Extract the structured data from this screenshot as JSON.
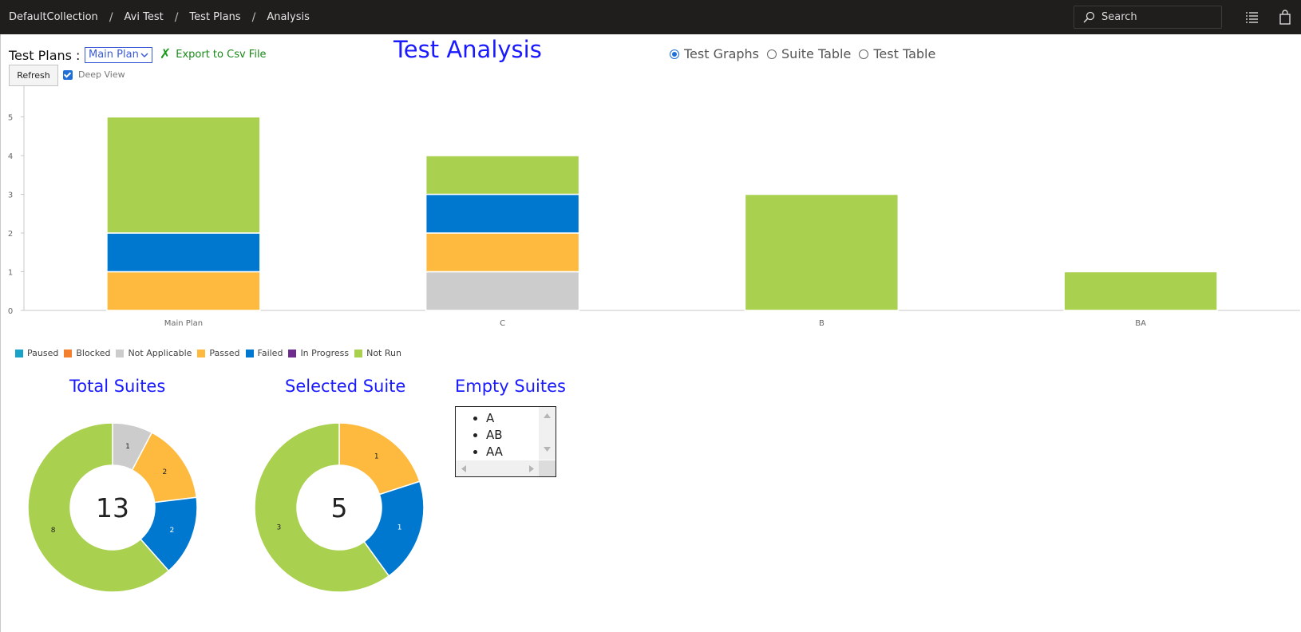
{
  "breadcrumb": [
    "DefaultCollection",
    "Avi Test",
    "Test Plans",
    "Analysis"
  ],
  "header": {
    "search_placeholder": "Search"
  },
  "controls": {
    "test_plans_label": "Test Plans :",
    "selected_plan": "Main Plan",
    "export_label": "Export to Csv File",
    "refresh_label": "Refresh",
    "deep_view_label": "Deep View",
    "deep_view_checked": true
  },
  "page_title": "Test Analysis",
  "view_options": [
    {
      "label": "Test Graphs",
      "selected": true
    },
    {
      "label": "Suite Table",
      "selected": false
    },
    {
      "label": "Test Table",
      "selected": false
    }
  ],
  "legend": [
    {
      "name": "Paused",
      "color": "#1aa3c9"
    },
    {
      "name": "Blocked",
      "color": "#f47f2c"
    },
    {
      "name": "Not Applicable",
      "color": "#cccccc"
    },
    {
      "name": "Passed",
      "color": "#fdba3f"
    },
    {
      "name": "Failed",
      "color": "#0078d0"
    },
    {
      "name": "In Progress",
      "color": "#6e2c8f"
    },
    {
      "name": "Not Run",
      "color": "#a9d04f"
    }
  ],
  "chart_data": [
    {
      "type": "bar",
      "stacked": true,
      "categories": [
        "Main Plan",
        "C",
        "B",
        "BA"
      ],
      "ylim": [
        0,
        6
      ],
      "yticks": [
        0,
        1,
        2,
        3,
        4,
        5,
        6
      ],
      "series": [
        {
          "name": "Paused",
          "values": [
            0,
            0,
            0,
            0
          ]
        },
        {
          "name": "Blocked",
          "values": [
            0,
            0,
            0,
            0
          ]
        },
        {
          "name": "Not Applicable",
          "values": [
            0,
            1,
            0,
            0
          ]
        },
        {
          "name": "Passed",
          "values": [
            1,
            1,
            0,
            0
          ]
        },
        {
          "name": "Failed",
          "values": [
            1,
            1,
            0,
            0
          ]
        },
        {
          "name": "In Progress",
          "values": [
            0,
            0,
            0,
            0
          ]
        },
        {
          "name": "Not Run",
          "values": [
            3,
            1,
            3,
            1
          ]
        }
      ],
      "legend": "bottom-left"
    },
    {
      "type": "pie",
      "donut": true,
      "title": "Total Suites",
      "center_label": "13",
      "slices": [
        {
          "name": "Not Applicable",
          "value": 1,
          "label": "1"
        },
        {
          "name": "Passed",
          "value": 2,
          "label": "2"
        },
        {
          "name": "Failed",
          "value": 2,
          "label": "2"
        },
        {
          "name": "Not Run",
          "value": 8,
          "label": "8"
        }
      ]
    },
    {
      "type": "pie",
      "donut": true,
      "title": "Selected Suite",
      "center_label": "5",
      "slices": [
        {
          "name": "Passed",
          "value": 1,
          "label": "1"
        },
        {
          "name": "Failed",
          "value": 1,
          "label": "1"
        },
        {
          "name": "Not Run",
          "value": 3,
          "label": "3"
        }
      ]
    }
  ],
  "empty_suites": {
    "title": "Empty Suites",
    "items": [
      "A",
      "AB",
      "AA"
    ]
  }
}
